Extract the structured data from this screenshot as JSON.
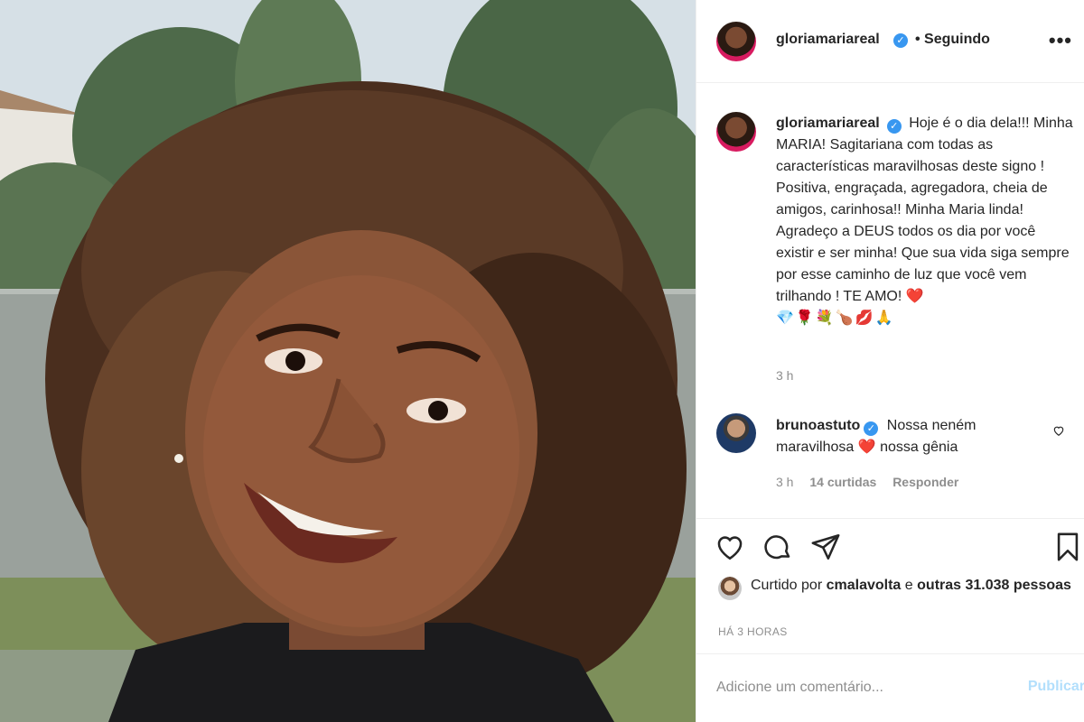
{
  "photo": {
    "alt": ""
  },
  "header": {
    "username": "gloriamariareal",
    "follow_status": "• Seguindo",
    "more_icon": "more-icon"
  },
  "caption": {
    "username": "gloriamariareal",
    "text": "Hoje é o dia dela!!! Minha MARIA! Sagitariana com todas as características maravilhosas deste signo ! Positiva, engraçada, agregadora, cheia de amigos, carinhosa!! Minha Maria linda! Agradeço a DEUS todos os dia por você existir e ser minha! Que sua vida siga sempre por esse caminho de luz que você vem trilhando ! TE AMO! ❤️",
    "emojis": "💎🌹💐🍗💋🙏",
    "time": "3 h"
  },
  "comment": {
    "username": "brunoastuto",
    "text_part1": "Nossa neném maravilhosa",
    "heart": "❤️",
    "text_part2": "nossa gênia",
    "time": "3 h",
    "likes": "14 curtidas",
    "reply": "Responder"
  },
  "likes": {
    "prefix": "Curtido por",
    "user": "cmalavolta",
    "mid": "e",
    "others": "outras 31.038 pessoas"
  },
  "ago": "HÁ 3 HORAS",
  "add_comment": {
    "placeholder": "Adicione um comentário...",
    "publish": "Publicar"
  },
  "colors": {
    "link_blue": "#3897f0",
    "publish_disabled": "#b2dffc",
    "muted": "#8e8e8e"
  }
}
